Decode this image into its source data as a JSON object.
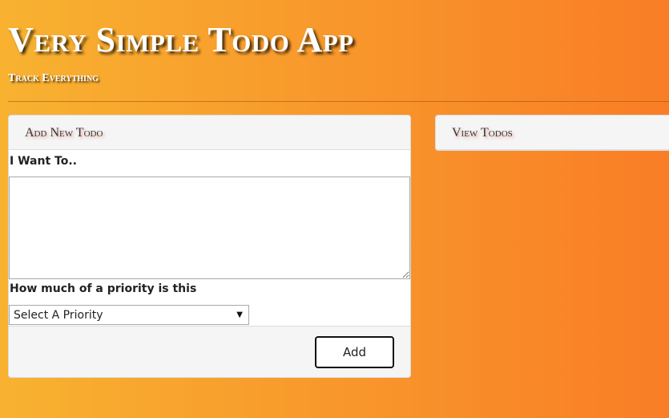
{
  "header": {
    "title": "Very Simple Todo App",
    "subtitle": "Track Everything"
  },
  "add_panel": {
    "heading": "Add New Todo",
    "want_label": "I Want To..",
    "textarea_value": "",
    "priority_label": "How much of a priority is this",
    "priority_select_value": "Select A Priority",
    "add_button_label": "Add"
  },
  "view_panel": {
    "heading": "View Todos"
  },
  "colors": {
    "background_gradient_start": "#f8b230",
    "background_gradient_end": "#f97d25",
    "panel_heading_bg": "#f5f5f5"
  }
}
